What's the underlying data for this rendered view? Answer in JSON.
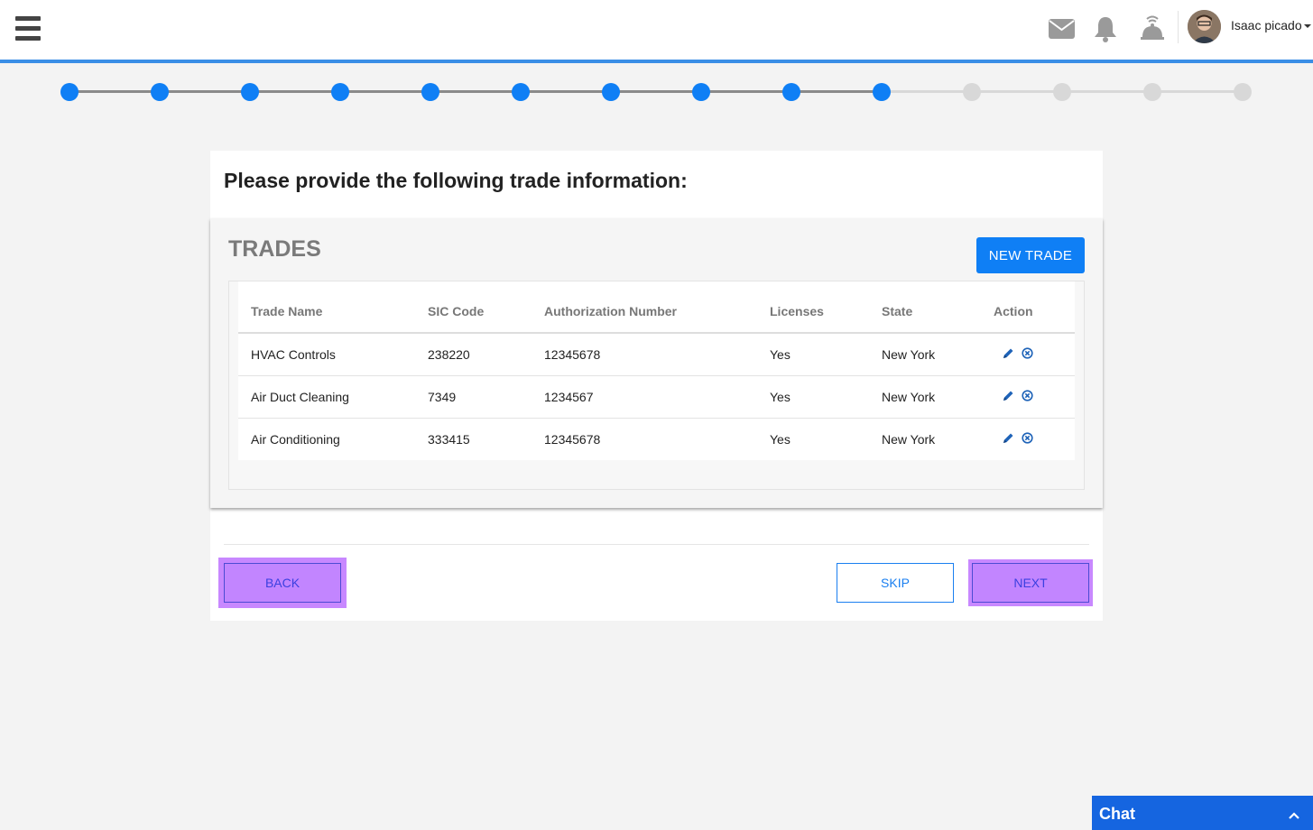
{
  "header": {
    "user_name": "Isaac picado",
    "icons": [
      "hamburger-menu-icon",
      "mail-icon",
      "bell-icon",
      "service-bell-icon",
      "avatar"
    ]
  },
  "stepper": {
    "total_steps": 14,
    "completed_steps": 10,
    "active_color": "#0f7ff5",
    "inactive_color": "#d8d8d8"
  },
  "page": {
    "title": "Please provide the following trade information:"
  },
  "trades": {
    "heading": "TRADES",
    "new_button": "NEW TRADE",
    "columns": [
      "Trade Name",
      "SIC Code",
      "Authorization Number",
      "Licenses",
      "State",
      "Action"
    ],
    "rows": [
      {
        "name": "HVAC Controls",
        "sic": "238220",
        "auth": "12345678",
        "licenses": "Yes",
        "state": "New York"
      },
      {
        "name": "Air Duct Cleaning",
        "sic": "7349",
        "auth": "1234567",
        "licenses": "Yes",
        "state": "New York"
      },
      {
        "name": "Air Conditioning",
        "sic": "333415",
        "auth": "12345678",
        "licenses": "Yes",
        "state": "New York"
      }
    ]
  },
  "footer": {
    "back": "BACK",
    "skip": "SKIP",
    "next": "NEXT"
  },
  "chat": {
    "label": "Chat"
  },
  "colors": {
    "primary": "#0f7ff5",
    "highlight": "#c285ff",
    "chat": "#1565e0"
  }
}
